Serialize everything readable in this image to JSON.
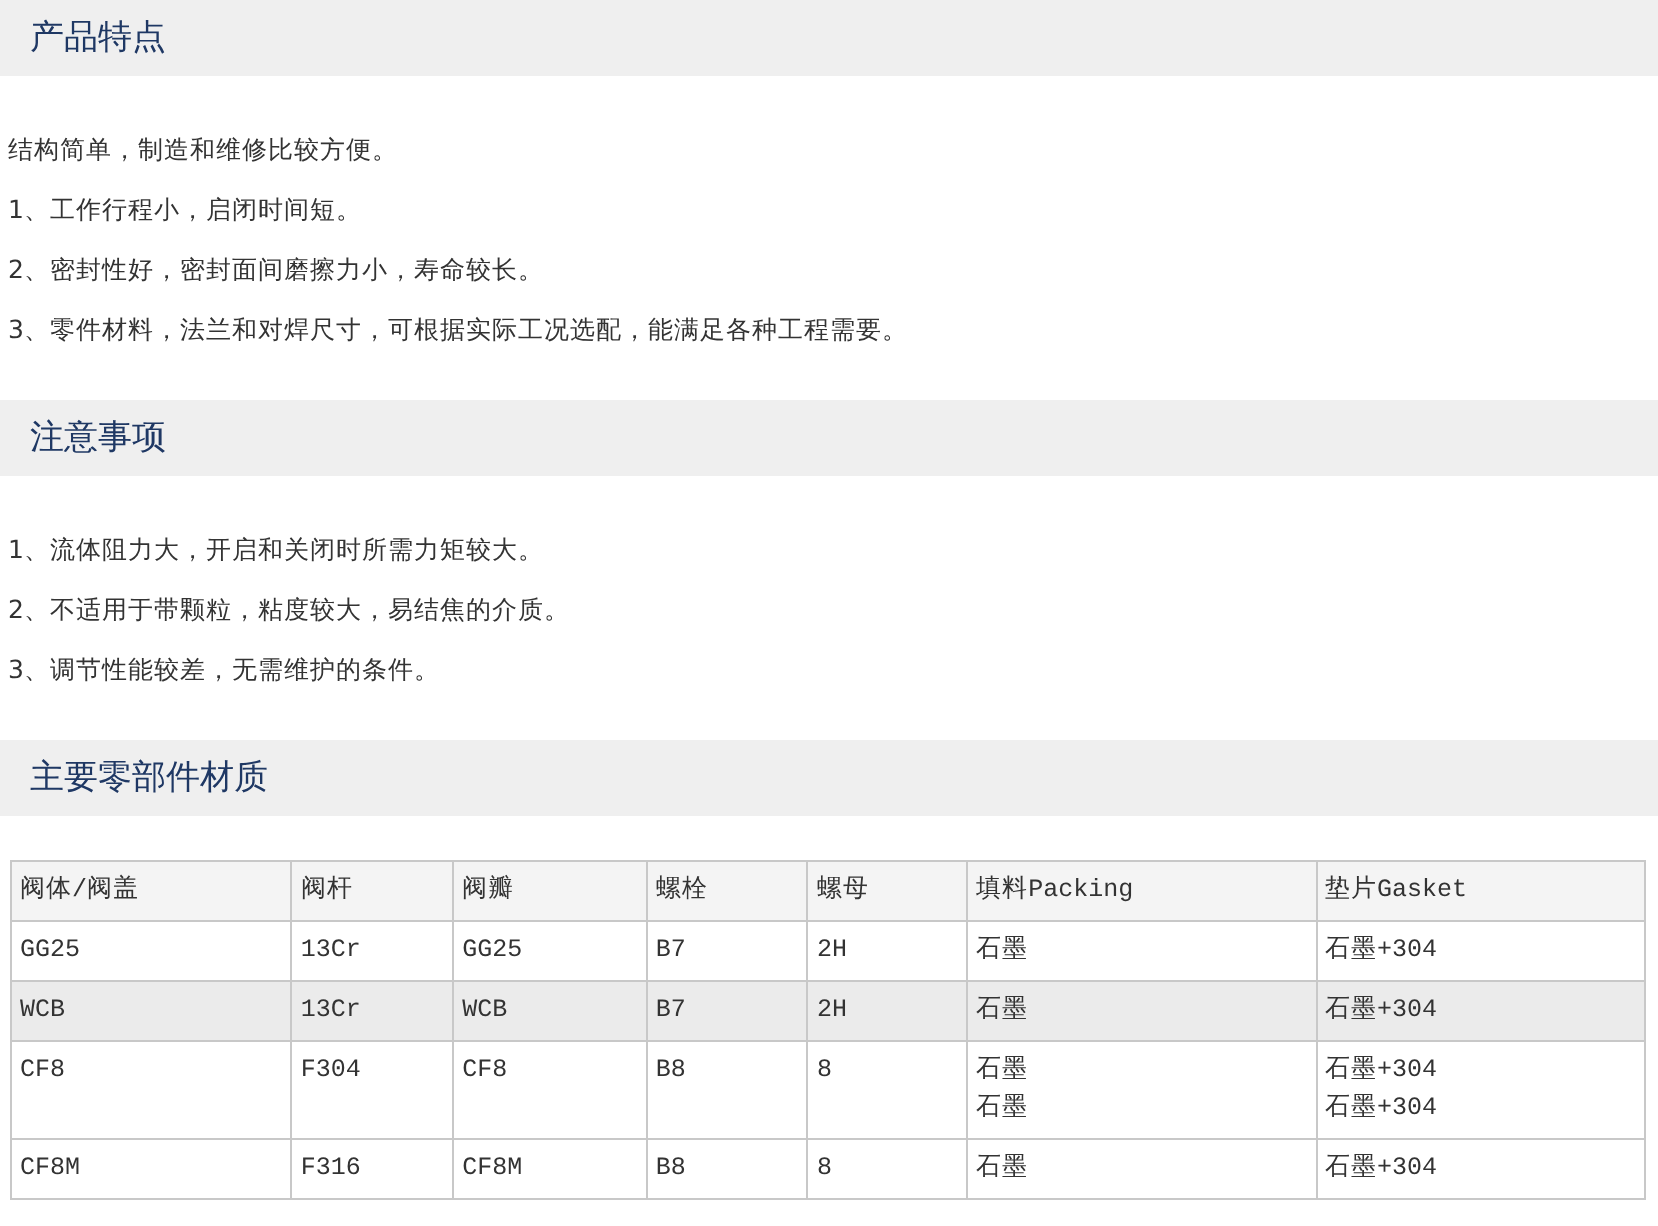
{
  "sections": [
    {
      "title": "产品特点",
      "paragraphs": [
        "结构简单，制造和维修比较方便。",
        "1、工作行程小，启闭时间短。",
        "2、密封性好，密封面间磨擦力小，寿命较长。",
        "3、零件材料，法兰和对焊尺寸，可根据实际工况选配，能满足各种工程需要。"
      ]
    },
    {
      "title": "注意事项",
      "paragraphs": [
        "1、流体阻力大，开启和关闭时所需力矩较大。",
        "2、不适用于带颗粒，粘度较大，易结焦的介质。",
        "3、调节性能较差，无需维护的条件。"
      ]
    },
    {
      "title": "主要零部件材质",
      "table": {
        "columns": [
          "阀体/阀盖",
          "阀杆",
          "阀瓣",
          "螺栓",
          "螺母",
          "填料Packing",
          "垫片Gasket"
        ],
        "rows": [
          {
            "shaded": false,
            "cells": [
              [
                "GG25"
              ],
              [
                "13Cr"
              ],
              [
                "GG25"
              ],
              [
                "B7"
              ],
              [
                "2H"
              ],
              [
                "石墨"
              ],
              [
                "石墨+304"
              ]
            ]
          },
          {
            "shaded": true,
            "cells": [
              [
                "WCB"
              ],
              [
                "13Cr"
              ],
              [
                "WCB"
              ],
              [
                "B7"
              ],
              [
                "2H"
              ],
              [
                "石墨"
              ],
              [
                "石墨+304"
              ]
            ]
          },
          {
            "shaded": false,
            "cells": [
              [
                "CF8"
              ],
              [
                "F304"
              ],
              [
                "CF8"
              ],
              [
                "B8"
              ],
              [
                "8"
              ],
              [
                "石墨",
                "石墨"
              ],
              [
                "石墨+304",
                "石墨+304"
              ]
            ]
          },
          {
            "shaded": false,
            "cells": [
              [
                "CF8M"
              ],
              [
                "F316"
              ],
              [
                "CF8M"
              ],
              [
                "B8"
              ],
              [
                "8"
              ],
              [
                "石墨"
              ],
              [
                "石墨+304"
              ]
            ]
          }
        ]
      }
    }
  ]
}
